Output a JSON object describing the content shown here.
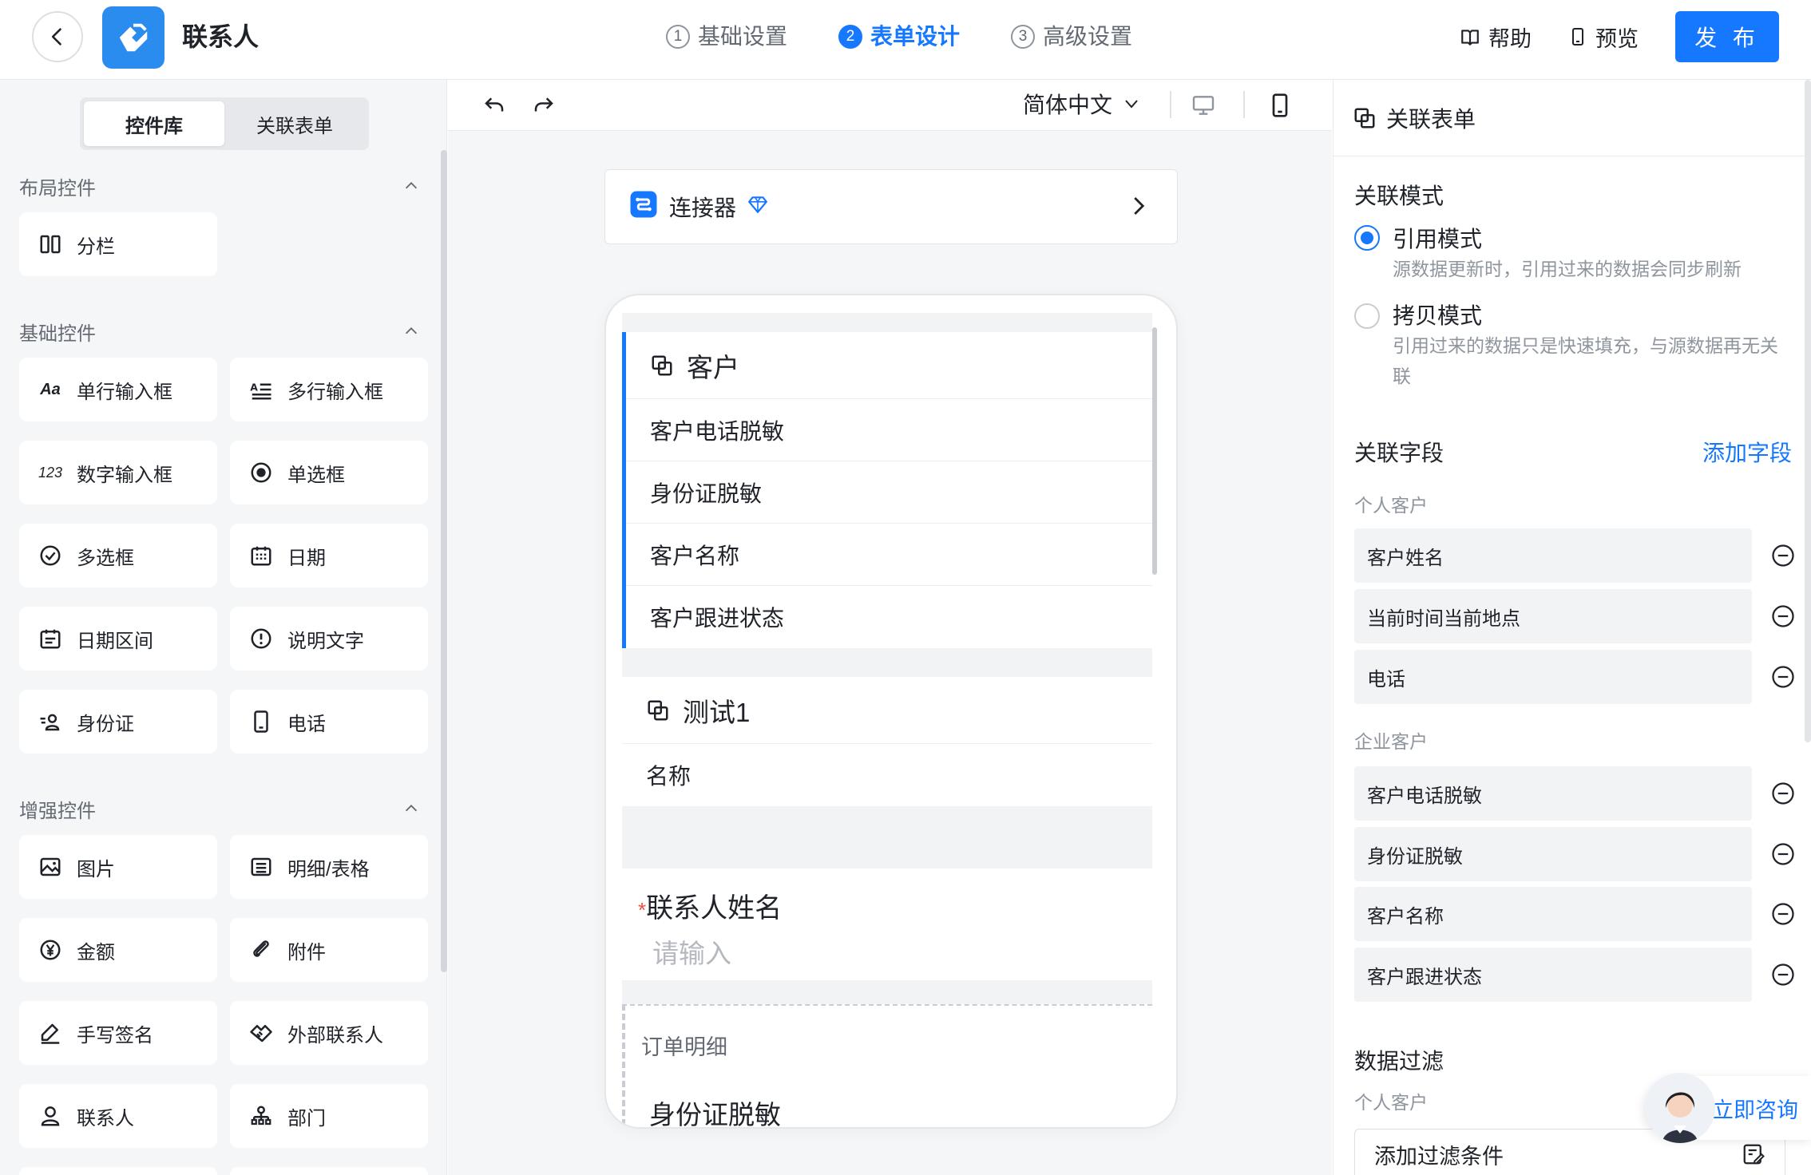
{
  "header": {
    "app_title": "联系人",
    "steps": [
      {
        "num": "1",
        "label": "基础设置"
      },
      {
        "num": "2",
        "label": "表单设计"
      },
      {
        "num": "3",
        "label": "高级设置"
      }
    ],
    "help_label": "帮助",
    "preview_label": "预览",
    "publish_label": "发 布"
  },
  "left": {
    "tabs": [
      "控件库",
      "关联表单"
    ],
    "sections": {
      "layout": "布局控件",
      "basic": "基础控件",
      "enhanced": "增强控件"
    },
    "layout_items": [
      {
        "label": "分栏",
        "icon": "columns-icon"
      }
    ],
    "basic_items": [
      {
        "label": "单行输入框",
        "icon": "text-aa-icon",
        "glyph": "Aa"
      },
      {
        "label": "多行输入框",
        "icon": "multiline-icon"
      },
      {
        "label": "数字输入框",
        "icon": "number-icon",
        "glyph": "123"
      },
      {
        "label": "单选框",
        "icon": "radio-icon"
      },
      {
        "label": "多选框",
        "icon": "checkbox-icon"
      },
      {
        "label": "日期",
        "icon": "calendar-icon"
      },
      {
        "label": "日期区间",
        "icon": "date-range-icon"
      },
      {
        "label": "说明文字",
        "icon": "info-icon"
      },
      {
        "label": "身份证",
        "icon": "id-card-icon"
      },
      {
        "label": "电话",
        "icon": "phone-icon"
      }
    ],
    "enhanced_items": [
      {
        "label": "图片",
        "icon": "image-icon"
      },
      {
        "label": "明细/表格",
        "icon": "table-icon"
      },
      {
        "label": "金额",
        "icon": "yen-icon"
      },
      {
        "label": "附件",
        "icon": "paperclip-icon"
      },
      {
        "label": "手写签名",
        "icon": "signature-icon"
      },
      {
        "label": "外部联系人",
        "icon": "handshake-icon"
      },
      {
        "label": "联系人",
        "icon": "user-icon"
      },
      {
        "label": "部门",
        "icon": "org-icon"
      }
    ]
  },
  "center": {
    "language": "简体中文",
    "connector_label": "连接器",
    "groups": [
      {
        "title": "客户",
        "rows": [
          "客户电话脱敏",
          "身份证脱敏",
          "客户名称",
          "客户跟进状态"
        ]
      },
      {
        "title": "测试1",
        "rows": [
          "名称"
        ]
      }
    ],
    "contact_field": {
      "required": "*",
      "label": "联系人姓名",
      "placeholder": "请输入"
    },
    "detail": {
      "title": "订单明细",
      "item": "身份证脱敏"
    }
  },
  "right": {
    "title": "关联表单",
    "mode_title": "关联模式",
    "modes": [
      {
        "label": "引用模式",
        "desc": "源数据更新时，引用过来的数据会同步刷新",
        "selected": true
      },
      {
        "label": "拷贝模式",
        "desc": "引用过来的数据只是快速填充，与源数据再无关联",
        "selected": false
      }
    ],
    "fields_title": "关联字段",
    "add_field": "添加字段",
    "personal_label": "个人客户",
    "personal_fields": [
      "客户姓名",
      "当前时间当前地点",
      "电话"
    ],
    "enterprise_label": "企业客户",
    "enterprise_fields": [
      "客户电话脱敏",
      "身份证脱敏",
      "客户名称",
      "客户跟进状态"
    ],
    "filter_title": "数据过滤",
    "filter_sub": "个人客户",
    "filter_placeholder": "添加过滤条件",
    "consult_label": "立即咨询"
  },
  "colors": {
    "accent": "#1677ff",
    "required": "#f54a45"
  }
}
